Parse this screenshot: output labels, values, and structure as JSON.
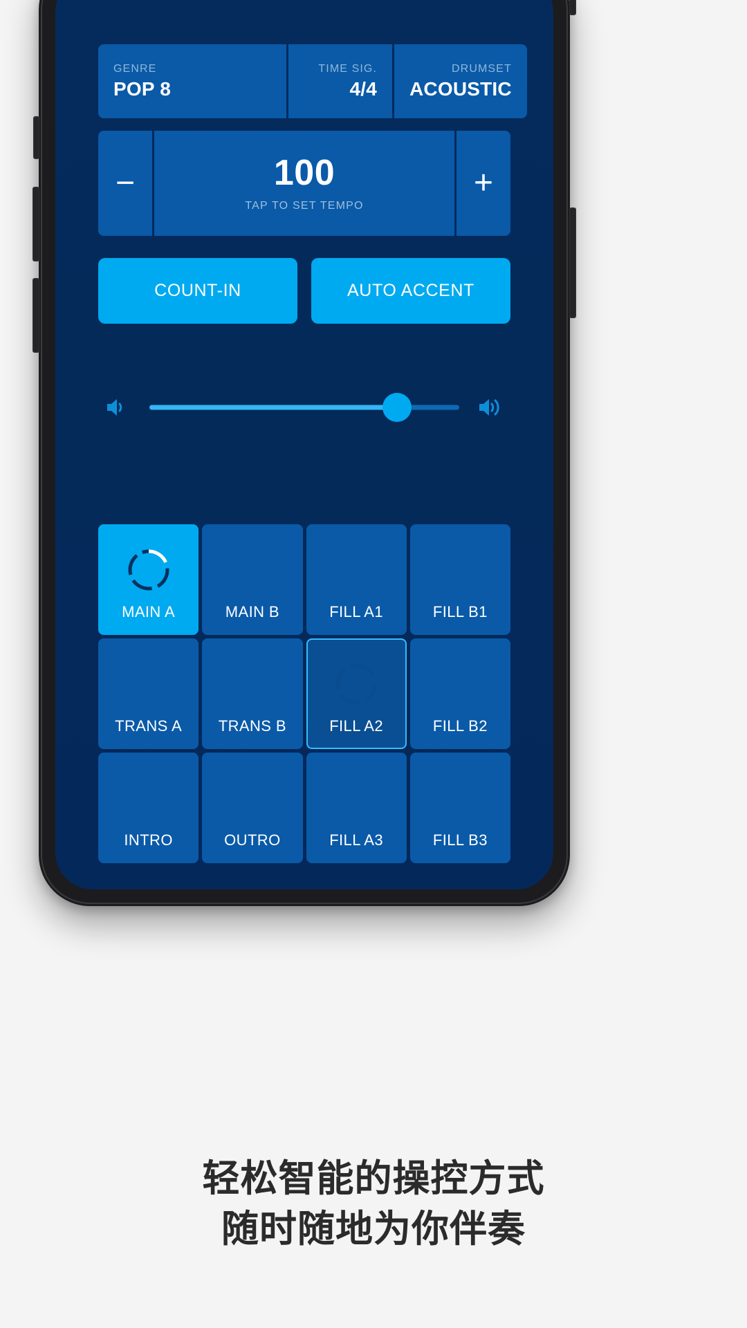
{
  "app": {
    "accent_bright": "#00aaf0",
    "accent_panel": "#0a5aa8",
    "background": "#042b5c",
    "page_background": "#f4f4f4"
  },
  "info_bar": {
    "genre": {
      "label": "GENRE",
      "value": "POP 8"
    },
    "time_signature": {
      "label": "TIME SIG.",
      "value": "4/4"
    },
    "drumset": {
      "label": "DRUMSET",
      "value": "ACOUSTIC"
    }
  },
  "tempo": {
    "decrease_label": "−",
    "increase_label": "+",
    "value": "100",
    "hint": "TAP TO SET TEMPO"
  },
  "toggles": [
    {
      "label": "COUNT-IN",
      "state": "on"
    },
    {
      "label": "AUTO ACCENT",
      "state": "on"
    }
  ],
  "volume": {
    "min_icon": "speaker-low-icon",
    "max_icon": "speaker-high-icon",
    "percent": 80
  },
  "pads": [
    {
      "label": "MAIN A",
      "state": "active",
      "ring": "playing"
    },
    {
      "label": "MAIN B",
      "state": "idle",
      "ring": "none"
    },
    {
      "label": "FILL A1",
      "state": "idle",
      "ring": "none"
    },
    {
      "label": "FILL B1",
      "state": "idle",
      "ring": "none"
    },
    {
      "label": "TRANS A",
      "state": "idle",
      "ring": "none"
    },
    {
      "label": "TRANS B",
      "state": "idle",
      "ring": "none"
    },
    {
      "label": "FILL A2",
      "state": "queued",
      "ring": "queued"
    },
    {
      "label": "FILL B2",
      "state": "idle",
      "ring": "none"
    },
    {
      "label": "INTRO",
      "state": "idle",
      "ring": "none"
    },
    {
      "label": "OUTRO",
      "state": "idle",
      "ring": "none"
    },
    {
      "label": "FILL A3",
      "state": "idle",
      "ring": "none"
    },
    {
      "label": "FILL B3",
      "state": "idle",
      "ring": "none"
    }
  ],
  "caption": {
    "line1": "轻松智能的操控方式",
    "line2": "随时随地为你伴奏"
  }
}
